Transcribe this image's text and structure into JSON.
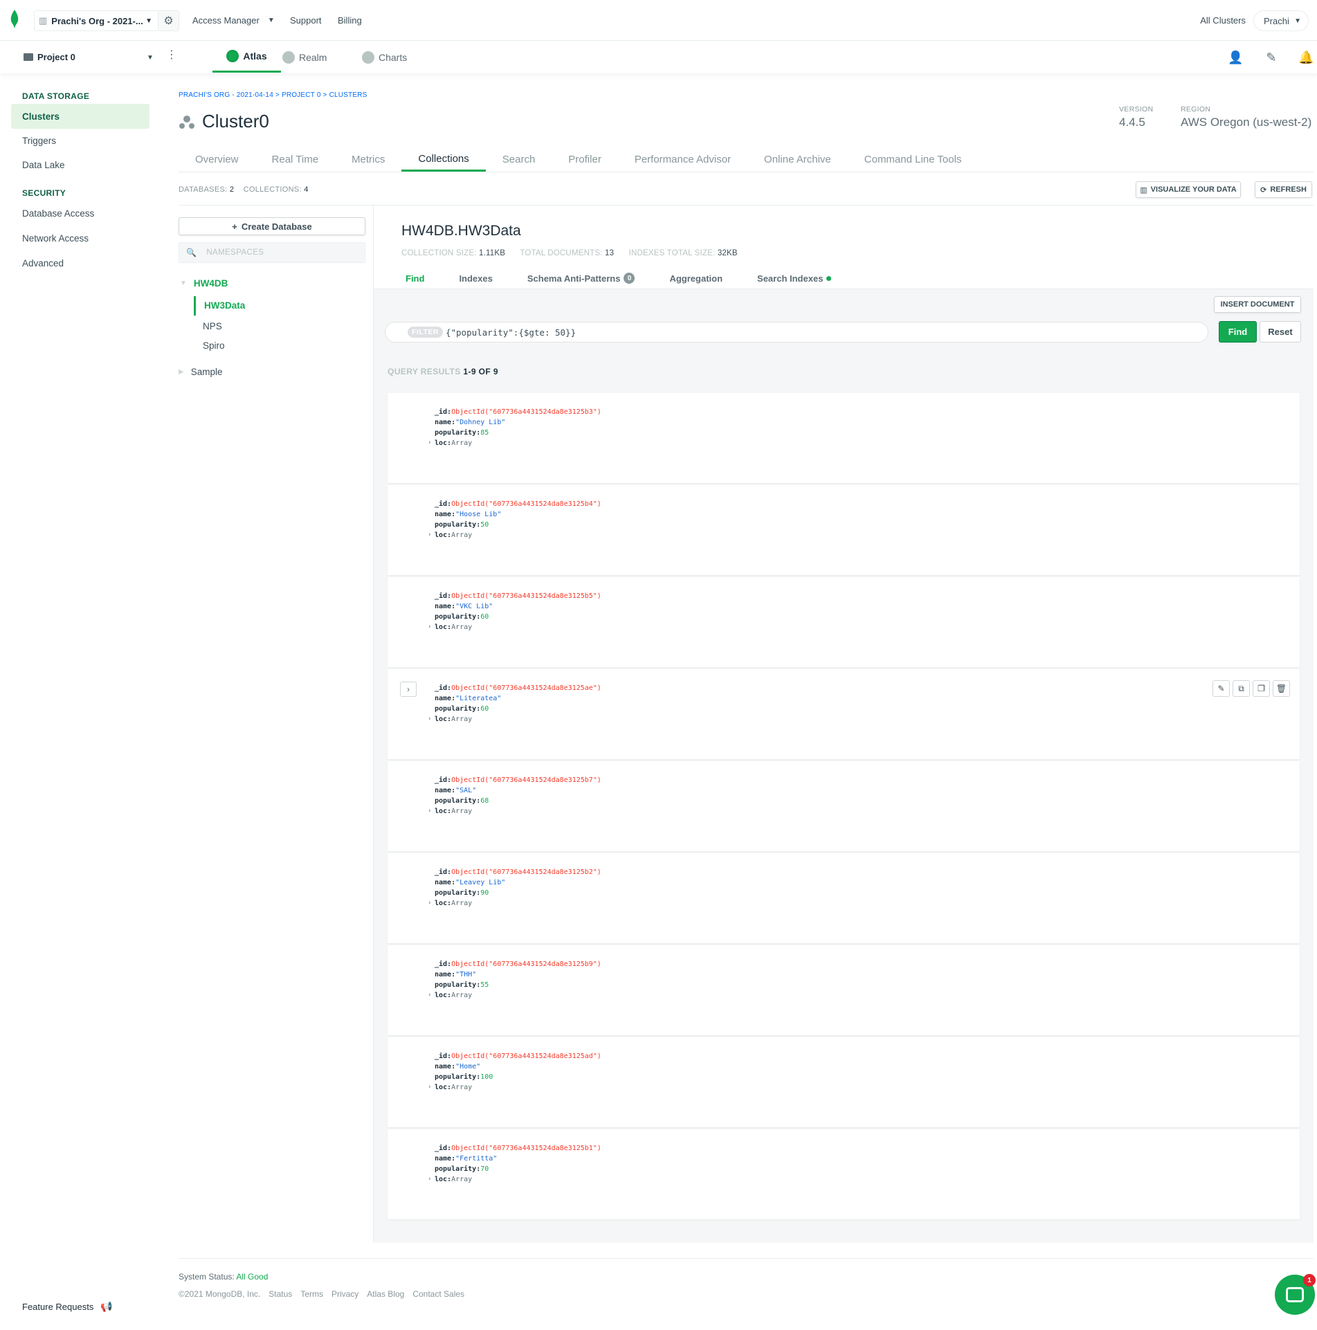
{
  "topbar": {
    "org_name": "Prachi's Org - 2021-...",
    "nav": [
      "Access Manager",
      "Support",
      "Billing"
    ],
    "all_clusters": "All Clusters",
    "user": "Prachi"
  },
  "secondbar": {
    "project": "Project 0",
    "tabs": [
      "Atlas",
      "Realm",
      "Charts"
    ],
    "active_tab": "Atlas"
  },
  "sidebar": {
    "data_storage_heading": "DATA STORAGE",
    "data_storage_items": [
      "Clusters",
      "Triggers",
      "Data Lake"
    ],
    "security_heading": "SECURITY",
    "security_items": [
      "Database Access",
      "Network Access",
      "Advanced"
    ],
    "feature_requests": "Feature Requests"
  },
  "header": {
    "breadcrumb": "PRACHI'S ORG - 2021-04-14 > PROJECT 0 > CLUSTERS",
    "cluster_name": "Cluster0",
    "version_label": "VERSION",
    "version": "4.4.5",
    "region_label": "REGION",
    "region": "AWS Oregon (us-west-2)"
  },
  "cluster_tabs": [
    "Overview",
    "Real Time",
    "Metrics",
    "Collections",
    "Search",
    "Profiler",
    "Performance Advisor",
    "Online Archive",
    "Command Line Tools"
  ],
  "active_cluster_tab": "Collections",
  "counts": {
    "databases_label": "DATABASES:",
    "databases": "2",
    "collections_label": "COLLECTIONS:",
    "collections": "4"
  },
  "actions": {
    "visualize": "VISUALIZE YOUR DATA",
    "refresh": "REFRESH"
  },
  "namespaces": {
    "create_database": "Create Database",
    "search_placeholder": "NAMESPACES",
    "databases": [
      {
        "name": "HW4DB",
        "expanded": true,
        "collections": [
          "HW3Data",
          "NPS",
          "Spiro"
        ],
        "active_collection": "HW3Data"
      },
      {
        "name": "Sample",
        "expanded": false,
        "collections": []
      }
    ]
  },
  "collection": {
    "title": "HW4DB.HW3Data",
    "size_label": "COLLECTION SIZE:",
    "size": "1.11KB",
    "docs_label": "TOTAL DOCUMENTS:",
    "docs": "13",
    "indexes_label": "INDEXES TOTAL SIZE:",
    "indexes": "32KB",
    "sub_tabs": [
      "Find",
      "Indexes",
      "Schema Anti-Patterns",
      "Aggregation",
      "Search Indexes"
    ],
    "antipatterns_count": "0",
    "insert_document": "INSERT DOCUMENT",
    "filter_tag": "FILTER",
    "filter_value": "{\"popularity\":{$gte: 50}}",
    "find_btn": "Find",
    "reset_btn": "Reset",
    "results_label": "QUERY RESULTS",
    "results_range": "1-9 OF 9"
  },
  "documents": [
    {
      "id": "ObjectId(\"607736a4431524da8e3125b3\")",
      "name": "\"Dohney Lib\"",
      "popularity": "85",
      "loc": "Array"
    },
    {
      "id": "ObjectId(\"607736a4431524da8e3125b4\")",
      "name": "\"Hoose Lib\"",
      "popularity": "50",
      "loc": "Array"
    },
    {
      "id": "ObjectId(\"607736a4431524da8e3125b5\")",
      "name": "\"VKC Lib\"",
      "popularity": "60",
      "loc": "Array"
    },
    {
      "id": "ObjectId(\"607736a4431524da8e3125ae\")",
      "name": "\"Literatea\"",
      "popularity": "60",
      "loc": "Array"
    },
    {
      "id": "ObjectId(\"607736a4431524da8e3125b7\")",
      "name": "\"SAL\"",
      "popularity": "68",
      "loc": "Array"
    },
    {
      "id": "ObjectId(\"607736a4431524da8e3125b2\")",
      "name": "\"Leavey Lib\"",
      "popularity": "90",
      "loc": "Array"
    },
    {
      "id": "ObjectId(\"607736a4431524da8e3125b9\")",
      "name": "\"THH\"",
      "popularity": "55",
      "loc": "Array"
    },
    {
      "id": "ObjectId(\"607736a4431524da8e3125ad\")",
      "name": "\"Home\"",
      "popularity": "100",
      "loc": "Array"
    },
    {
      "id": "ObjectId(\"607736a4431524da8e3125b1\")",
      "name": "\"Fertitta\"",
      "popularity": "70",
      "loc": "Array"
    }
  ],
  "doc_keys": {
    "id": "_id:",
    "name": "name:",
    "popularity": "popularity:",
    "loc": "loc:"
  },
  "footer": {
    "status_label": "System Status:",
    "status_value": "All Good",
    "copyright": "©2021 MongoDB, Inc.",
    "links": [
      "Status",
      "Terms",
      "Privacy",
      "Atlas Blog",
      "Contact Sales"
    ]
  },
  "chat": {
    "badge": "1"
  },
  "colors": {
    "accent": "#13aa52",
    "oid": "#f43b2a",
    "string": "#1967d2",
    "link": "#016bf8"
  }
}
